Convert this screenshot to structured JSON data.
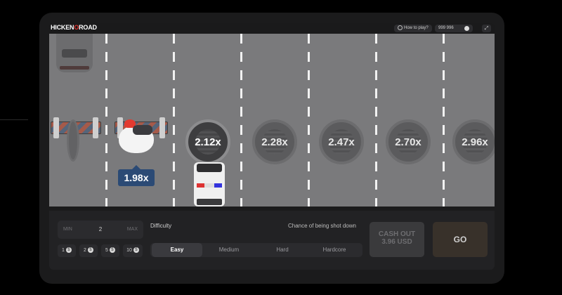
{
  "header": {
    "logo_prefix": "HICKEN",
    "logo_o": "O",
    "logo_suffix": "ROAD",
    "how_to_play": "How to play?",
    "balance": "999 996",
    "fullscreen_icon": "fullscreen-icon"
  },
  "game": {
    "current_multiplier": "1.98x",
    "next_multipliers": [
      "2.12x",
      "2.28x",
      "2.47x",
      "2.70x",
      "2.96x"
    ]
  },
  "controls": {
    "bet": {
      "min_label": "MIN",
      "value": "2",
      "max_label": "MAX"
    },
    "quick_bets": [
      "1",
      "2",
      "5",
      "10"
    ],
    "coin_glyph": "$",
    "difficulty_label": "Difficulty",
    "chance_label": "Chance of being shot down",
    "difficulties": [
      "Easy",
      "Medium",
      "Hard",
      "Hardcore"
    ],
    "selected_difficulty": "Easy",
    "cashout_line1": "CASH OUT",
    "cashout_line2": "3.96 USD",
    "go_label": "GO"
  },
  "colors": {
    "accent_red": "#e3342f",
    "label_blue": "#2b4a75",
    "road": "#7a7a7c"
  }
}
